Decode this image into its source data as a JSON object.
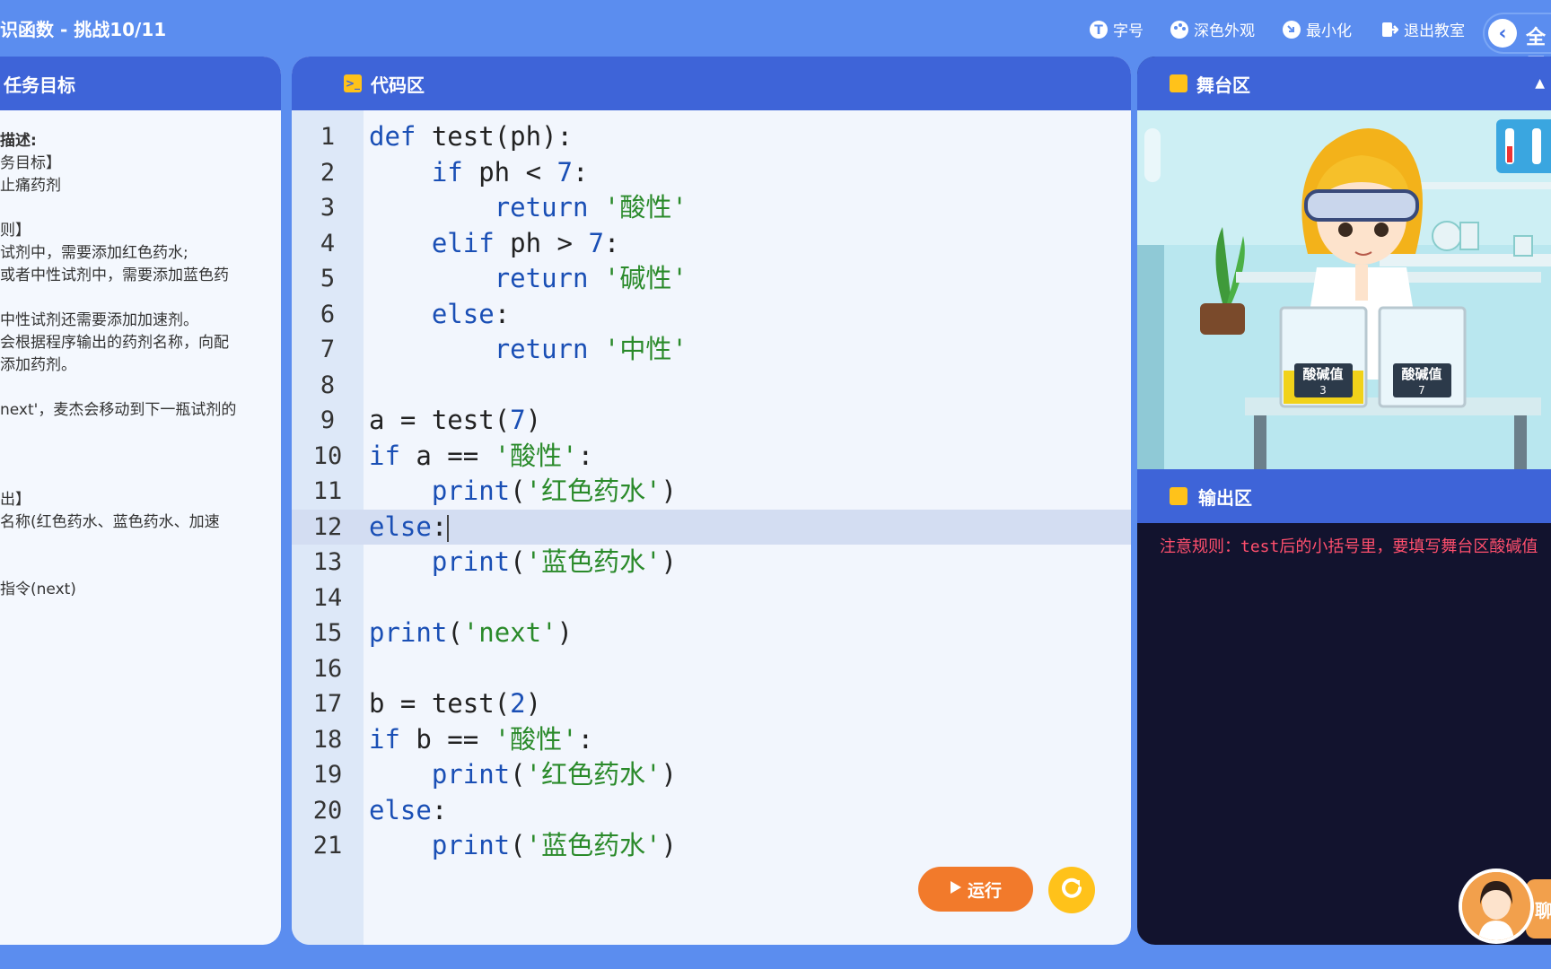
{
  "header": {
    "title": "识函数 - 挑战10/11",
    "buttons": [
      {
        "label": "字号",
        "icon": "font-size-icon"
      },
      {
        "label": "深色外观",
        "icon": "palette-icon"
      },
      {
        "label": "最小化",
        "icon": "minimize-icon"
      },
      {
        "label": "退出教室",
        "icon": "exit-icon"
      }
    ],
    "fullscreen_label": "全屏"
  },
  "task_panel": {
    "title": "任务目标",
    "lines": [
      "描述:",
      "务目标】",
      "止痛药剂",
      "",
      "则】",
      "试剂中，需要添加红色药水;",
      "或者中性试剂中，需要添加蓝色药",
      "",
      "  中性试剂还需要添加加速剂。",
      "会根据程序输出的药剂名称，向配",
      "添加药剂。",
      "",
      "next'，麦杰会移动到下一瓶试剂的",
      "",
      "",
      "",
      "出】",
      "名称(红色药水、蓝色药水、加速",
      "",
      "",
      "指令(next)"
    ]
  },
  "code_panel": {
    "title": "代码区",
    "active_line": 12,
    "lines": [
      [
        [
          "kw",
          "def"
        ],
        [
          "t",
          " test(ph):"
        ]
      ],
      [
        [
          "t",
          "    "
        ],
        [
          "kw",
          "if"
        ],
        [
          "t",
          " ph < "
        ],
        [
          "num",
          "7"
        ],
        [
          "t",
          ":"
        ]
      ],
      [
        [
          "t",
          "        "
        ],
        [
          "kw",
          "return"
        ],
        [
          "t",
          " "
        ],
        [
          "str",
          "'酸性'"
        ]
      ],
      [
        [
          "t",
          "    "
        ],
        [
          "kw",
          "elif"
        ],
        [
          "t",
          " ph > "
        ],
        [
          "num",
          "7"
        ],
        [
          "t",
          ":"
        ]
      ],
      [
        [
          "t",
          "        "
        ],
        [
          "kw",
          "return"
        ],
        [
          "t",
          " "
        ],
        [
          "str",
          "'碱性'"
        ]
      ],
      [
        [
          "t",
          "    "
        ],
        [
          "kw",
          "else"
        ],
        [
          "t",
          ":"
        ]
      ],
      [
        [
          "t",
          "        "
        ],
        [
          "kw",
          "return"
        ],
        [
          "t",
          " "
        ],
        [
          "str",
          "'中性'"
        ]
      ],
      [],
      [
        [
          "t",
          "a = test("
        ],
        [
          "num",
          "7"
        ],
        [
          "t",
          ")"
        ]
      ],
      [
        [
          "kw",
          "if"
        ],
        [
          "t",
          " a == "
        ],
        [
          "str",
          "'酸性'"
        ],
        [
          "t",
          ":"
        ]
      ],
      [
        [
          "t",
          "    "
        ],
        [
          "kw",
          "print"
        ],
        [
          "t",
          "("
        ],
        [
          "str",
          "'红色药水'"
        ],
        [
          "t",
          ")"
        ]
      ],
      [
        [
          "kw",
          "else"
        ],
        [
          "t",
          ":"
        ]
      ],
      [
        [
          "t",
          "    "
        ],
        [
          "kw",
          "print"
        ],
        [
          "t",
          "("
        ],
        [
          "str",
          "'蓝色药水'"
        ],
        [
          "t",
          ")"
        ]
      ],
      [],
      [
        [
          "kw",
          "print"
        ],
        [
          "t",
          "("
        ],
        [
          "str",
          "'next'"
        ],
        [
          "t",
          ")"
        ]
      ],
      [],
      [
        [
          "t",
          "b = test("
        ],
        [
          "num",
          "2"
        ],
        [
          "t",
          ")"
        ]
      ],
      [
        [
          "kw",
          "if"
        ],
        [
          "t",
          " b == "
        ],
        [
          "str",
          "'酸性'"
        ],
        [
          "t",
          ":"
        ]
      ],
      [
        [
          "t",
          "    "
        ],
        [
          "kw",
          "print"
        ],
        [
          "t",
          "("
        ],
        [
          "str",
          "'红色药水'"
        ],
        [
          "t",
          ")"
        ]
      ],
      [
        [
          "kw",
          "else"
        ],
        [
          "t",
          ":"
        ]
      ],
      [
        [
          "t",
          "    "
        ],
        [
          "kw",
          "print"
        ],
        [
          "t",
          "("
        ],
        [
          "str",
          "'蓝色药水'"
        ],
        [
          "t",
          ")"
        ]
      ]
    ],
    "run_label": "运行",
    "reset_icon": "refresh-icon"
  },
  "stage_panel": {
    "title": "舞台区",
    "beakers": [
      {
        "label": "酸碱值",
        "value": "3",
        "fill_color": "#f1d21a"
      },
      {
        "label": "酸碱值",
        "value": "7",
        "fill_color": "#e8f4f8"
      }
    ]
  },
  "output_panel": {
    "title": "输出区",
    "message": "注意规则：test后的小括号里，要填写舞台区酸碱值"
  },
  "colors": {
    "background": "#5b8def",
    "panel_header": "#3e64d8",
    "accent_yellow": "#ffc21a",
    "run_button": "#f27a2b",
    "output_background": "#12132e",
    "output_text": "#ff4f6d"
  }
}
